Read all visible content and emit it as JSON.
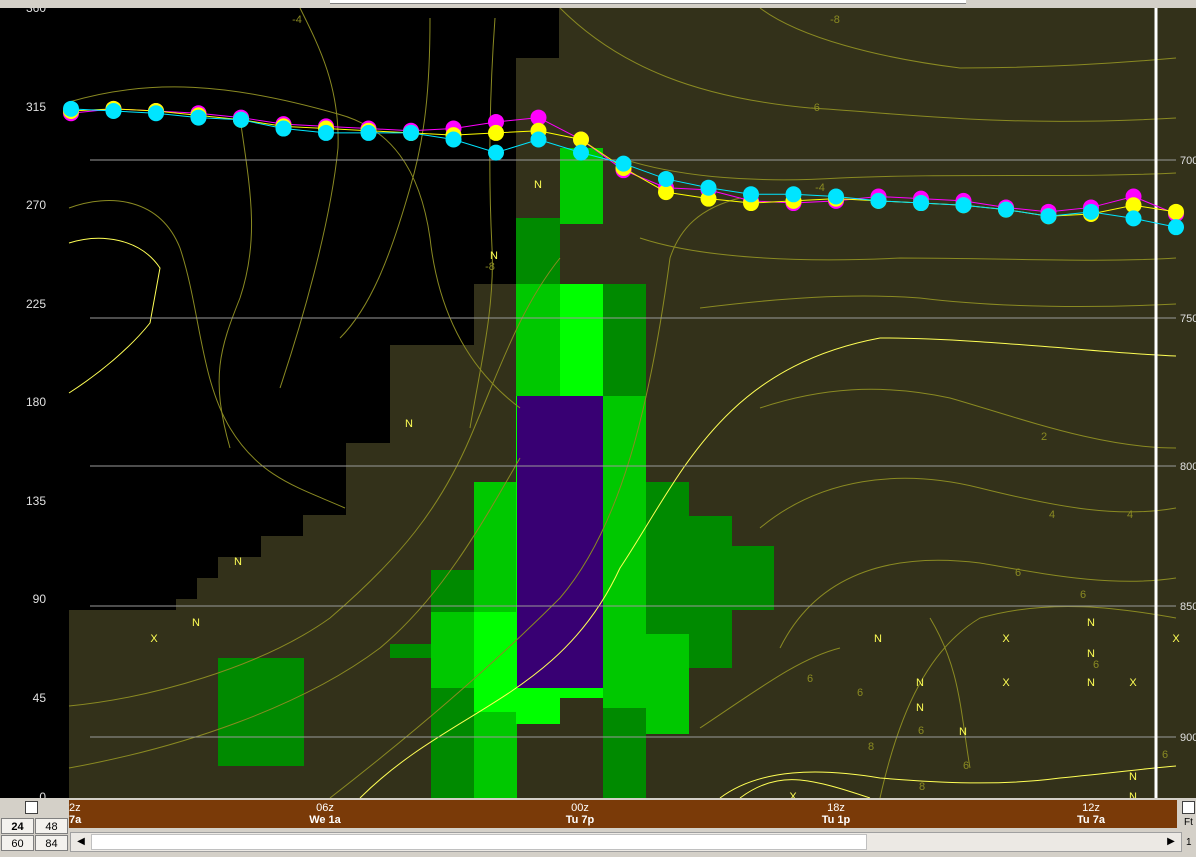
{
  "chart_data": {
    "type": "time-height cross section",
    "left_axis_ticks": [
      "360",
      "315",
      "270",
      "225",
      "180",
      "135",
      "90",
      "45",
      "0"
    ],
    "right_axis_ticks": [
      "700",
      "750",
      "800",
      "850",
      "900"
    ],
    "time_labels": [
      {
        "top": "2z",
        "bottom": "7a"
      },
      {
        "top": "06z",
        "bottom": "We 1a"
      },
      {
        "top": "00z",
        "bottom": "Tu 7p"
      },
      {
        "top": "18z",
        "bottom": "Tu 1p"
      },
      {
        "top": "12z",
        "bottom": "Tu 7a"
      }
    ],
    "contour_labels": [
      "-4",
      "-8",
      "-6",
      "-4",
      "-8",
      "2",
      "4",
      "4",
      "6",
      "6",
      "6",
      "6",
      "6",
      "6",
      "6",
      "8",
      "8",
      "6"
    ],
    "series": [
      {
        "color": "#ff00ff",
        "values": [
          312,
          314,
          313,
          312,
          310,
          307,
          306,
          305,
          304,
          305,
          308,
          310,
          300,
          286,
          278,
          277,
          272,
          271,
          272,
          274,
          273,
          272,
          269,
          267,
          269,
          274,
          266
        ]
      },
      {
        "color": "#ffff00",
        "values": [
          313,
          314,
          313,
          311,
          309,
          306,
          305,
          304,
          303,
          302,
          303,
          304,
          300,
          287,
          276,
          273,
          271,
          272,
          273,
          272,
          271,
          270,
          268,
          265,
          266,
          270,
          267
        ]
      },
      {
        "color": "#00e5ff",
        "values": [
          314,
          313,
          312,
          310,
          309,
          305,
          303,
          303,
          303,
          300,
          294,
          300,
          294,
          289,
          282,
          278,
          275,
          275,
          274,
          272,
          271,
          270,
          268,
          265,
          267,
          264,
          260
        ]
      }
    ],
    "symbols": [
      "N",
      "N",
      "N",
      "N",
      "N",
      "N",
      "N",
      "N",
      "N",
      "N",
      "N",
      "N",
      "N",
      "N",
      "X",
      "X",
      "X",
      "X",
      "X",
      "X"
    ]
  },
  "controls": {
    "hours": [
      "24",
      "48",
      "60",
      "84"
    ],
    "ft_label": "Ft",
    "one_label": "1"
  },
  "colors": {
    "background": "#000000",
    "terrain": "#33311a",
    "contour": "#8a8a22",
    "bright_contour": "#ffff55",
    "precip_light": "#00ff00",
    "precip_mid": "#00c800",
    "precip_dark": "#008a00",
    "precip_heavy": "#380073",
    "timebar": "#7a3a08"
  }
}
